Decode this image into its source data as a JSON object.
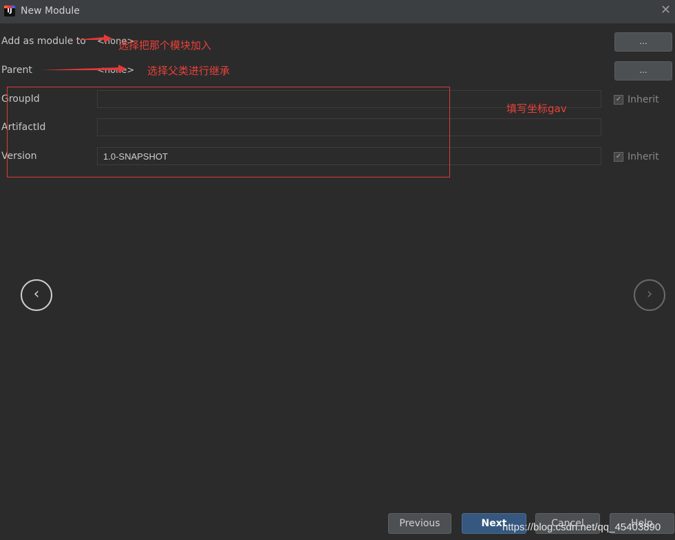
{
  "window": {
    "title": "New Module",
    "app_icon_text": "IJ"
  },
  "form": {
    "add_as_module_to": {
      "label": "Add as module to",
      "value": "<none>"
    },
    "parent": {
      "label": "Parent",
      "value": "<none>"
    },
    "group_id": {
      "label": "GroupId",
      "value": ""
    },
    "artifact_id": {
      "label": "ArtifactId",
      "value": ""
    },
    "version": {
      "label": "Version",
      "value": "1.0-SNAPSHOT"
    },
    "browse_label": "...",
    "inherit_label": "Inherit"
  },
  "annotations": {
    "module_note": "选择把那个模块加入",
    "parent_note": "选择父类进行继承",
    "gav_note": "填写坐标gav",
    "color": "#e8413a"
  },
  "footer": {
    "previous": "Previous",
    "next": "Next",
    "cancel": "Cancel",
    "help": "Help"
  },
  "watermark": "https://blog.csdn.net/qq_45403890",
  "icons": {
    "close": "close-icon",
    "back": "chevron-left-icon",
    "forward": "chevron-right-icon",
    "checkbox": "checkbox-checked-icon"
  }
}
